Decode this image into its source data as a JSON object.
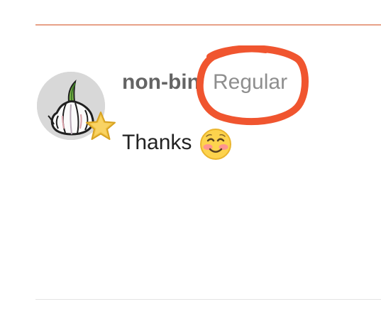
{
  "post": {
    "username": "non-binary",
    "user_title": "Regular",
    "message": "Thanks",
    "avatar_icon": "garlic-icon",
    "flair_icon": "star-badge-icon",
    "reaction_emoji": "smiling-face-with-blush-icon"
  },
  "colors": {
    "top_divider": "#e8a188",
    "annotation_circle": "#f0552f",
    "username": "#646464",
    "user_title": "#8e8e8e",
    "message_text": "#222222"
  }
}
